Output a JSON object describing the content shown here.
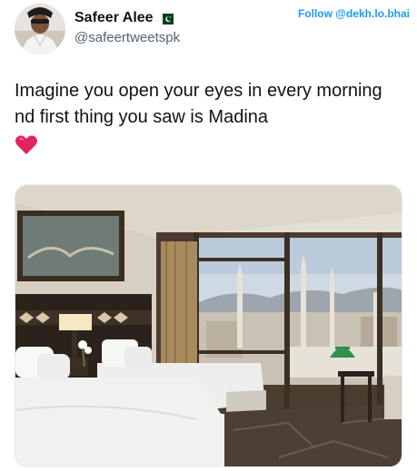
{
  "author": {
    "display_name": "Safeer Alee",
    "handle": "@safeertweetspk",
    "flag_icon": "pakistan-flag-icon"
  },
  "follow_watermark": "Follow @dekh.lo.bhai",
  "tweet": {
    "text": "Imagine you open your eyes in every morning nd first thing you saw is Madina",
    "emoji": "red-heart-icon"
  },
  "media": {
    "type": "photo",
    "subject": "hotel-room-view-of-masjid-nabawi"
  },
  "colors": {
    "name": "#0f1419",
    "handle": "#536471",
    "link": "#1d9bf0",
    "heart": "#e0245e",
    "dome": "#2f8f4e"
  }
}
